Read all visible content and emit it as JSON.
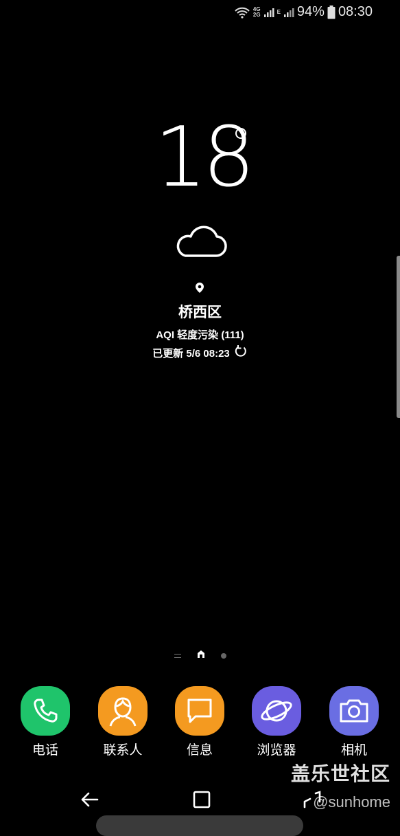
{
  "status": {
    "net_top": "4G",
    "net_bottom": "2G",
    "net2": "E",
    "battery": "94%",
    "time": "08:30"
  },
  "weather": {
    "temperature": "18",
    "condition_icon": "cloud-icon",
    "location": "桥西区",
    "aqi": "AQI 轻度污染 (111)",
    "updated": "已更新 5/6 08:23"
  },
  "dock": {
    "apps": [
      {
        "label": "电话",
        "icon": "phone-icon",
        "color": "#1fc46b"
      },
      {
        "label": "联系人",
        "icon": "contacts-icon",
        "color": "#f49a20"
      },
      {
        "label": "信息",
        "icon": "message-icon",
        "color": "#f49a20"
      },
      {
        "label": "浏览器",
        "icon": "browser-icon",
        "color": "#6a5de0"
      },
      {
        "label": "相机",
        "icon": "camera-icon",
        "color": "#6a6ee3"
      }
    ]
  },
  "watermark": {
    "title": "盖乐世社区",
    "sub": "@sunhome"
  }
}
